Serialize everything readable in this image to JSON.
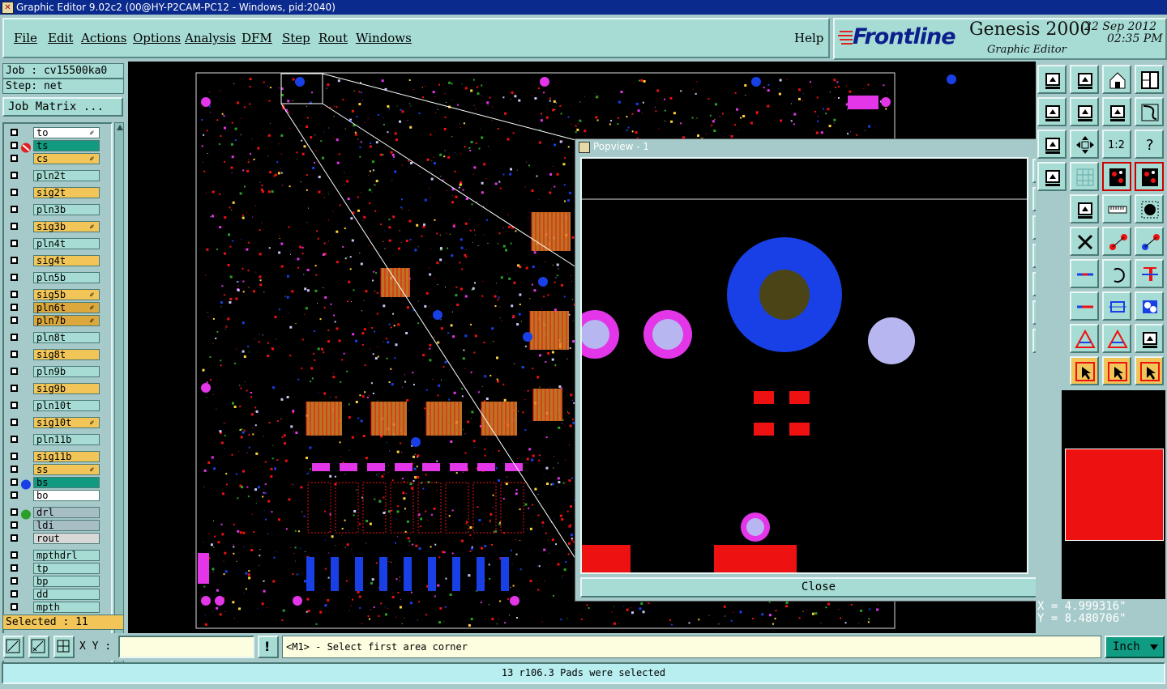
{
  "window": {
    "title": "Graphic Editor 9.02c2 (00@HY-P2CAM-PC12 - Windows, pid:2040)"
  },
  "menu": {
    "items": [
      "File",
      "Edit",
      "Actions",
      "Options",
      "Analysis",
      "DFM",
      "Step",
      "Rout",
      "Windows"
    ],
    "help": "Help"
  },
  "brand": {
    "logo": "Frontline",
    "product": "Genesis 2000",
    "subtitle": "Graphic Editor",
    "date": "22  Sep  2012",
    "time": "02:35  PM"
  },
  "job": {
    "job_label": "Job : cv15500ka0",
    "step_label": "Step: net",
    "matrix_button": "Job Matrix ..."
  },
  "layers": [
    {
      "name": "to",
      "color": "#ffffff",
      "edit": true
    },
    {
      "name": "ts",
      "color": "#119a80",
      "edit": false,
      "active": true
    },
    {
      "name": "cs",
      "color": "#f1c558",
      "edit": true
    },
    {
      "name": "pln2t",
      "color": "#a6dcd4",
      "edit": false
    },
    {
      "name": "sig2t",
      "color": "#f1c558",
      "edit": false
    },
    {
      "name": "pln3b",
      "color": "#a6dcd4",
      "edit": false
    },
    {
      "name": "sig3b",
      "color": "#f1c558",
      "edit": true
    },
    {
      "name": "pln4t",
      "color": "#a6dcd4",
      "edit": false
    },
    {
      "name": "sig4t",
      "color": "#f1c558",
      "edit": false
    },
    {
      "name": "pln5b",
      "color": "#a6dcd4",
      "edit": false
    },
    {
      "name": "sig5b",
      "color": "#f1c558",
      "edit": true
    },
    {
      "name": "pln6t",
      "color": "#dca83c",
      "edit": true
    },
    {
      "name": "pln7b",
      "color": "#dca83c",
      "edit": true
    },
    {
      "name": "pln8t",
      "color": "#a6dcd4",
      "edit": false
    },
    {
      "name": "sig8t",
      "color": "#f1c558",
      "edit": false
    },
    {
      "name": "pln9b",
      "color": "#a6dcd4",
      "edit": false
    },
    {
      "name": "sig9b",
      "color": "#f1c558",
      "edit": false
    },
    {
      "name": "pln10t",
      "color": "#a6dcd4",
      "edit": false
    },
    {
      "name": "sig10t",
      "color": "#f1c558",
      "edit": true
    },
    {
      "name": "pln11b",
      "color": "#a6dcd4",
      "edit": false
    },
    {
      "name": "sig11b",
      "color": "#f1c558",
      "edit": false
    },
    {
      "name": "ss",
      "color": "#f1c558",
      "edit": true
    },
    {
      "name": "bs",
      "color": "#119a80",
      "edit": false
    },
    {
      "name": "bo",
      "color": "#ffffff",
      "edit": false
    },
    {
      "name": "drl",
      "color": "#a6bec4",
      "edit": false
    },
    {
      "name": "ldi",
      "color": "#a6bec4",
      "edit": false
    },
    {
      "name": "rout",
      "color": "#d8d8d8",
      "edit": false
    },
    {
      "name": "mpthdrl",
      "color": "#a6dcd4",
      "edit": false
    },
    {
      "name": "tp",
      "color": "#a6dcd4",
      "edit": false
    },
    {
      "name": "bp",
      "color": "#a6dcd4",
      "edit": false
    },
    {
      "name": "dd",
      "color": "#a6dcd4",
      "edit": false
    },
    {
      "name": "mpth",
      "color": "#a6dcd4",
      "edit": false
    }
  ],
  "selected": "Selected : 11",
  "popview": {
    "title": "Popview - 1",
    "close_label": "Close"
  },
  "coords": {
    "x": "X  = 4.999316\"",
    "y": "Y  = 8.480706\""
  },
  "bottom": {
    "xy_label": "X Y :",
    "xy_value": "",
    "prompt": "<M1> - Select first area corner",
    "units": "Inch"
  },
  "status": "13 r106.3 Pads were selected"
}
